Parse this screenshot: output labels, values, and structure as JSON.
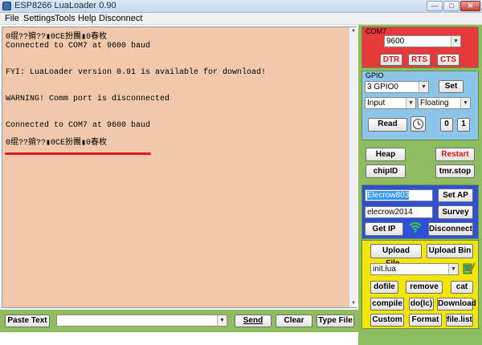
{
  "window": {
    "title": "ESP8266 LuaLoader 0.90",
    "controls": {
      "minimize": "—",
      "maximize": "□",
      "close": "✕"
    }
  },
  "menu": [
    "File",
    "Settings",
    "Tools",
    "Help",
    "Disconnect"
  ],
  "terminal": {
    "lines": [
      "0绲??掮??▮0CE扮團▮0春枚",
      "Connected to COM7 at 9600 baud",
      "",
      "",
      "FYI: LuaLoader version 0.91 is available for download!",
      "",
      "",
      "WARNING! Comm port is disconnected",
      "",
      "",
      "Connected to COM7 at 9600 baud",
      "",
      "0绲??掮??▮0CE扮團▮0春枚"
    ]
  },
  "bottom_bar": {
    "paste_text": "Paste Text",
    "input_value": "",
    "send": "Send",
    "clear": "Clear",
    "type_file": "Type File"
  },
  "com_panel": {
    "label": "COM7",
    "baud": "9600",
    "dtr": "DTR",
    "rts": "RTS",
    "cts": "CTS"
  },
  "gpio_panel": {
    "label": "GPIO",
    "pin": "3 GPIO0",
    "set": "Set",
    "mode": "Input",
    "pull": "Floating",
    "read": "Read",
    "zero": "0",
    "one": "1"
  },
  "sys_panel": {
    "heap": "Heap",
    "restart": "Restart",
    "chipid": "chipID",
    "tmrstop": "tmr.stop"
  },
  "wifi_panel": {
    "ssid": "Elecrow803",
    "set_ap": "Set AP",
    "password": "elecrow2014",
    "survey": "Survey",
    "get_ip": "Get IP",
    "disconnect": "Disconnect"
  },
  "files_panel": {
    "upload_file": "Upload File...",
    "upload_bin": "Upload Bin",
    "file": "init.lua",
    "dofile": "dofile",
    "remove": "remove",
    "cat": "cat",
    "compile": "compile",
    "dolc": "do(lc)",
    "download": "Download",
    "custom": "Custom",
    "format": "Format",
    "filelist": "file.list"
  },
  "colors": {
    "terminal_bg": "#f1c8ab",
    "panel_green": "#8fbc5f",
    "com_red": "#e63a3a",
    "gpio_blue": "#8bc6ea",
    "wifi_blue": "#2f4fd7",
    "files_yellow": "#f2e600",
    "annotation_red": "#e21b1b"
  },
  "icons": {
    "app": "app-icon",
    "timer": "clock-icon",
    "wifi": "wifi-icon",
    "edit": "notepad-icon"
  }
}
